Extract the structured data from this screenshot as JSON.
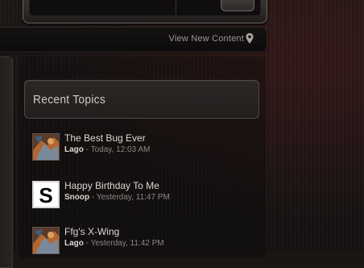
{
  "nav": {
    "view_new_content": "View New Content"
  },
  "recent_topics": {
    "title": "Recent Topics",
    "items": [
      {
        "title": "The Best Bug Ever",
        "author": "Lago",
        "time": "Today, 12:03 AM",
        "avatar": "lago-avatar"
      },
      {
        "title": "Happy Birthday To Me",
        "author": "Snoop",
        "time": "Yesterday, 11:47 PM",
        "avatar": "snoop-avatar",
        "avatar_letter": "S"
      },
      {
        "title": "Ffg's X-Wing",
        "author": "Lago",
        "time": "Yesterday, 11:42 PM",
        "avatar": "lago-avatar"
      }
    ]
  },
  "icons": {
    "view_new": "map-pin-icon"
  },
  "colors": {
    "background": "#1b1514",
    "panel": "#2b2726",
    "text": "#dcd8d5",
    "muted": "#8a8683"
  }
}
